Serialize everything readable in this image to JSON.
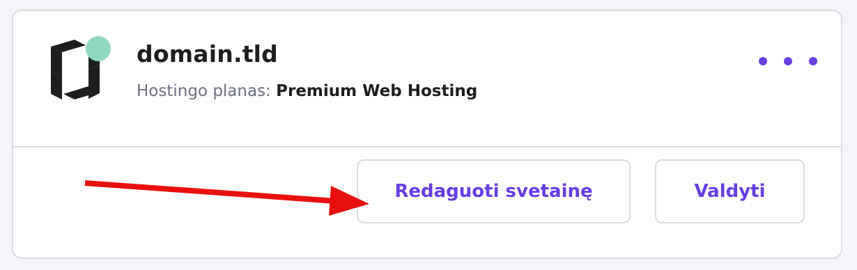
{
  "site": {
    "domain": "domain.tld",
    "plan_label": "Hostingo planas:",
    "plan_value": "Premium Web Hosting",
    "status_color": "#8fd9bf",
    "logo_icon": "hostinger-logo-icon"
  },
  "menu": {
    "icon": "more-horizontal-icon"
  },
  "actions": {
    "edit_label": "Redaguoti svetainę",
    "manage_label": "Valdyti"
  },
  "annotation": {
    "color": "#e8100e",
    "icon": "red-arrow-pointer"
  },
  "colors": {
    "accent": "#673de6",
    "text": "#1d1e20",
    "muted": "#6d7081",
    "border": "#dadce0",
    "background": "#f4f4fb"
  }
}
